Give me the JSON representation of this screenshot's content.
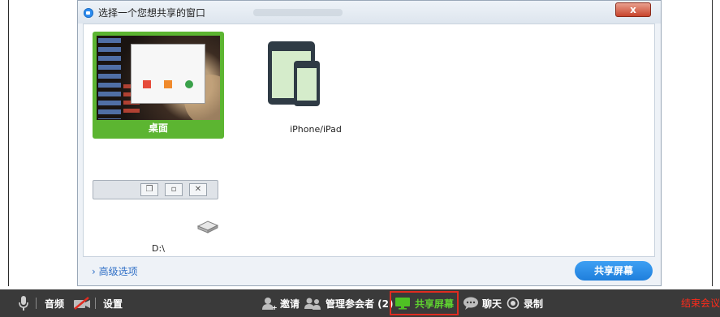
{
  "dialog": {
    "title": "选择一个您想共享的窗口",
    "close_label": "x",
    "tiles": [
      {
        "label": "桌面",
        "selected": true
      },
      {
        "label": "iPhone/iPad",
        "selected": false
      },
      {
        "label": "D:\\",
        "selected": false
      }
    ],
    "advanced_link": "› 高级选项",
    "share_button": "共享屏幕"
  },
  "toolbar": {
    "audio": "音频",
    "settings": "设置",
    "invite": "邀请",
    "manage": "管理参会者 (2)",
    "share_screen": "共享屏幕",
    "chat": "聊天",
    "record": "录制",
    "end": "结束会议"
  },
  "colors": {
    "selected_tile": "#5cb531",
    "accent_blue": "#1f7fdc",
    "toolbar_bg": "#3a3a3a",
    "highlight_border": "#e02b20",
    "end_text": "#ff2a1a"
  }
}
